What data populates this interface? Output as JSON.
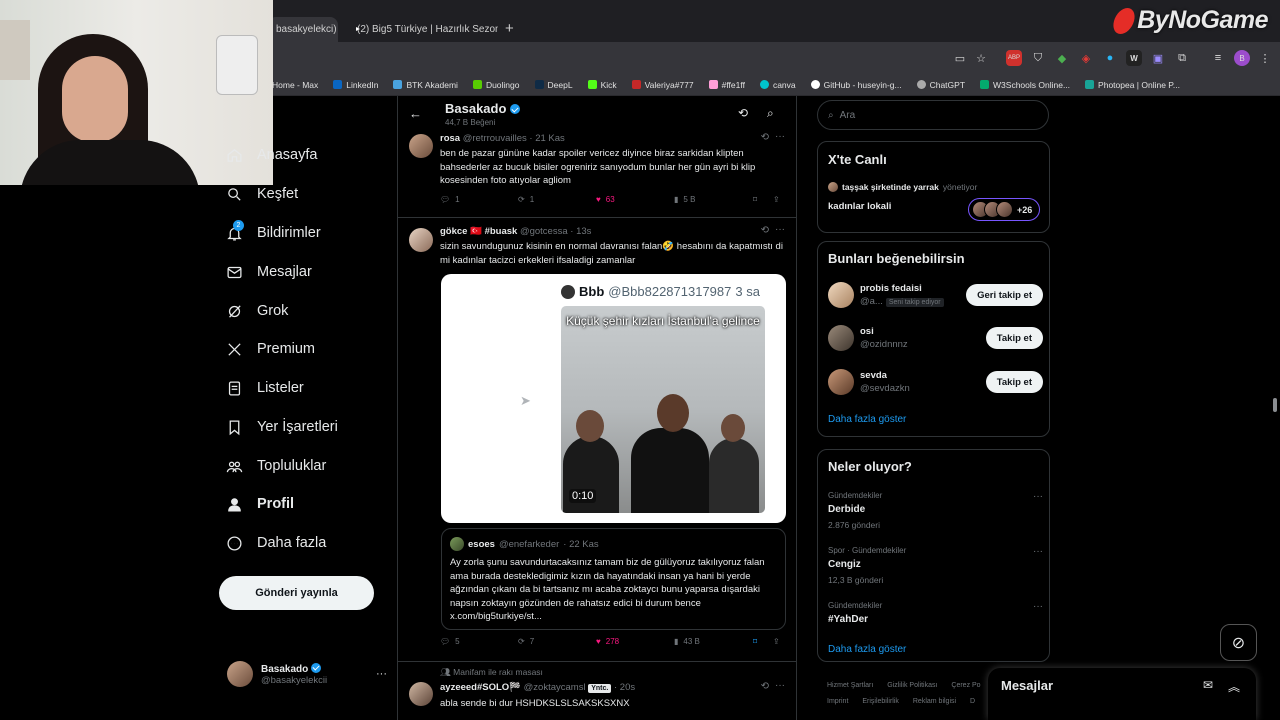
{
  "browser": {
    "tabs": [
      {
        "label": "basakyelekci) / X",
        "active": true
      },
      {
        "label": "(2) Big5 Türkiye | Hazırlık Sezon",
        "active": false
      }
    ],
    "new_tab": "+",
    "bookmarks": [
      "Home - Max",
      "LinkedIn",
      "BTK Akademi",
      "Duolingo",
      "DeepL",
      "Kick",
      "Valeriya#777",
      "#ffe1ff",
      "canva",
      "GitHub - huseyin-g...",
      "ChatGPT",
      "W3Schools Online...",
      "Photopea | Online P..."
    ]
  },
  "watermark": "ByNoGame",
  "nav": {
    "items": [
      {
        "label": "Anasayfa",
        "icon": "home-icon"
      },
      {
        "label": "Keşfet",
        "icon": "search-icon"
      },
      {
        "label": "Bildirimler",
        "icon": "bell-icon",
        "badge": "2"
      },
      {
        "label": "Mesajlar",
        "icon": "mail-icon"
      },
      {
        "label": "Grok",
        "icon": "grok-icon"
      },
      {
        "label": "Premium",
        "icon": "x-logo-icon"
      },
      {
        "label": "Listeler",
        "icon": "list-icon"
      },
      {
        "label": "Yer İşaretleri",
        "icon": "bookmark-icon"
      },
      {
        "label": "Topluluklar",
        "icon": "communities-icon"
      },
      {
        "label": "Profil",
        "icon": "profile-icon"
      },
      {
        "label": "Daha fazla",
        "icon": "more-circle-icon"
      }
    ],
    "post_button": "Gönderi yayınla",
    "account": {
      "name": "Basakado",
      "handle": "@basakyelekcii"
    }
  },
  "header": {
    "name": "Basakado",
    "subtitle": "44,7 B Beğeni"
  },
  "tweets": [
    {
      "name": "rosa",
      "handle": "@retrrouvailles",
      "time": "· 21 Kas",
      "text": "ben de pazar gününe kadar spoiler vericez diyince biraz sarkidan klipten bahsederler az bucuk bisiler ogreniriz sanıyodum bunlar her gün ayri bi klip kosesinden foto atıyolar agliom",
      "replies": "1",
      "reposts": "1",
      "likes": "63",
      "views": "5 B"
    },
    {
      "name": "gökce 🇹🇷 #buask",
      "handle": "@gotcessa",
      "time": "· 13s",
      "text": "sizin savundugunuz kisinin en normal davranısı falan🤣 hesabını da kapatmıstı di mi kadınlar tacizci erkekleri ifsaladigi zamanlar",
      "media": {
        "inner_name": "Bbb",
        "inner_handle": "@Bbb822871317987",
        "inner_time": "3 sa",
        "caption": "Küçük şehir kızları İstanbul'a gelince",
        "duration": "0:10"
      },
      "quote": {
        "name": "esoes",
        "handle": "@enefarkeder",
        "time": "· 22 Kas",
        "text": "Ay zorla şunu savundurtacaksınız tamam biz de gülüyoruz takılıyoruz falan ama burada destekledigimiz kızın da hayatındaki insan ya hani bi yerde ağzından çıkanı da bi tartsanız mı acaba zoktaycı bunu yaparsa dışardaki napsın zoktayın gözünden de rahatsız edici bi durum bence x.com/big5turkiye/st..."
      },
      "replies": "5",
      "reposts": "7",
      "likes": "278",
      "views": "43 B"
    },
    {
      "context": "Manifam ile rakı masası",
      "name": "ayzeeed#SOLO🏁",
      "handle": "@zoktaycamsl",
      "pill": "Yntc.",
      "time": "· 20s",
      "text": "abla sende bi dur HSHDKSLSLSAKSKSXNX"
    }
  ],
  "right": {
    "search_placeholder": "Ara",
    "live": {
      "title": "X'te Canlı",
      "host": "taşşak şirketinde yarrak",
      "host_suffix": "yönetiyor",
      "topic": "kadınlar lokali",
      "count": "+26"
    },
    "suggestions": {
      "title": "Bunları beğenebilirsin",
      "items": [
        {
          "name": "probis fedaisi",
          "handle": "@a...",
          "follows_you": "Seni takip ediyor",
          "button": "Geri takip et"
        },
        {
          "name": "osi",
          "handle": "@ozidnnnz",
          "button": "Takip et"
        },
        {
          "name": "sevda",
          "handle": "@sevdazkn",
          "button": "Takip et"
        }
      ],
      "more": "Daha fazla göster"
    },
    "trends": {
      "title": "Neler oluyor?",
      "items": [
        {
          "category": "Gündemdekiler",
          "name": "Derbide",
          "count": "2.876 gönderi"
        },
        {
          "category": "Spor · Gündemdekiler",
          "name": "Cengiz",
          "count": "12,3 B gönderi"
        },
        {
          "category": "Gündemdekiler",
          "name": "#YahDer",
          "count": ""
        }
      ],
      "more": "Daha fazla göster"
    },
    "footer": [
      "Hizmet Şartları",
      "Gizlilik Politikası",
      "Çerez Po"
    ],
    "footer2": [
      "Imprint",
      "Erişilebilirlik",
      "Reklam bilgisi",
      "D"
    ]
  },
  "messages_drawer": {
    "title": "Mesajlar"
  }
}
